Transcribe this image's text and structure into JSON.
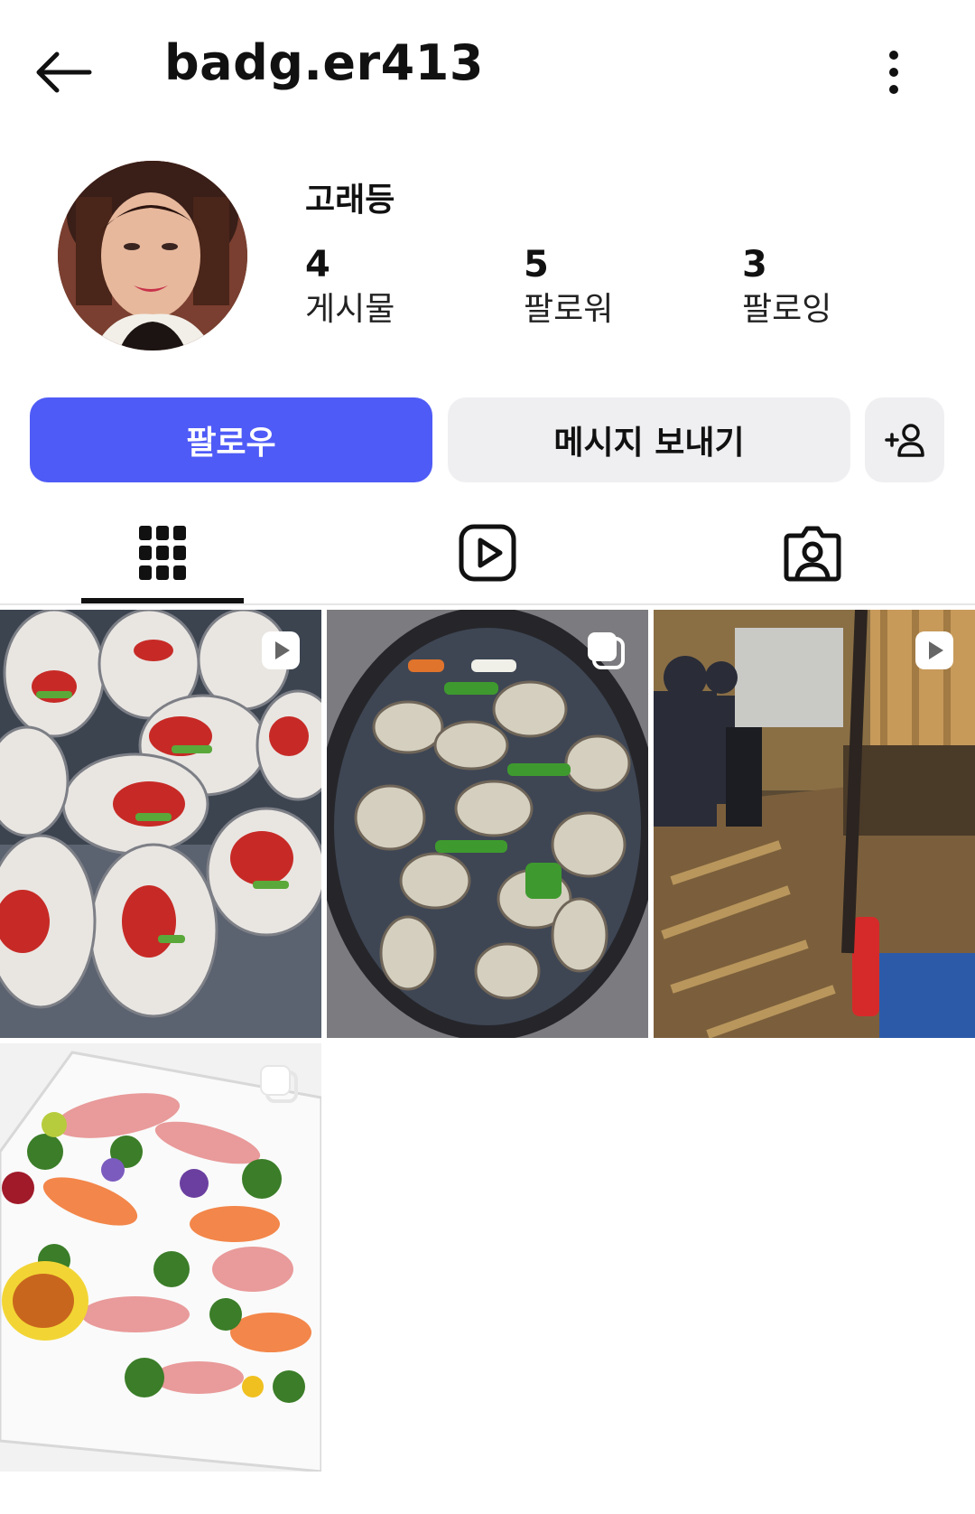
{
  "header": {
    "username": "badg.er413"
  },
  "profile": {
    "display_name": "고래등",
    "stats": [
      {
        "count": "4",
        "label": "게시물"
      },
      {
        "count": "5",
        "label": "팔로워"
      },
      {
        "count": "3",
        "label": "팔로잉"
      }
    ]
  },
  "actions": {
    "follow_label": "팔로우",
    "message_label": "메시지 보내기"
  },
  "tabs": [
    {
      "icon": "grid-icon",
      "selected": true
    },
    {
      "icon": "reels-icon",
      "selected": false
    },
    {
      "icon": "tagged-icon",
      "selected": false
    }
  ],
  "posts": [
    {
      "subject": "oysters",
      "type": "reel"
    },
    {
      "subject": "clam soup",
      "type": "carousel"
    },
    {
      "subject": "restaurant interior",
      "type": "reel"
    },
    {
      "subject": "sashimi platter",
      "type": "carousel"
    }
  ],
  "colors": {
    "accent": "#4f5bf6",
    "secondary_button": "#efeff1",
    "text": "#111111"
  }
}
